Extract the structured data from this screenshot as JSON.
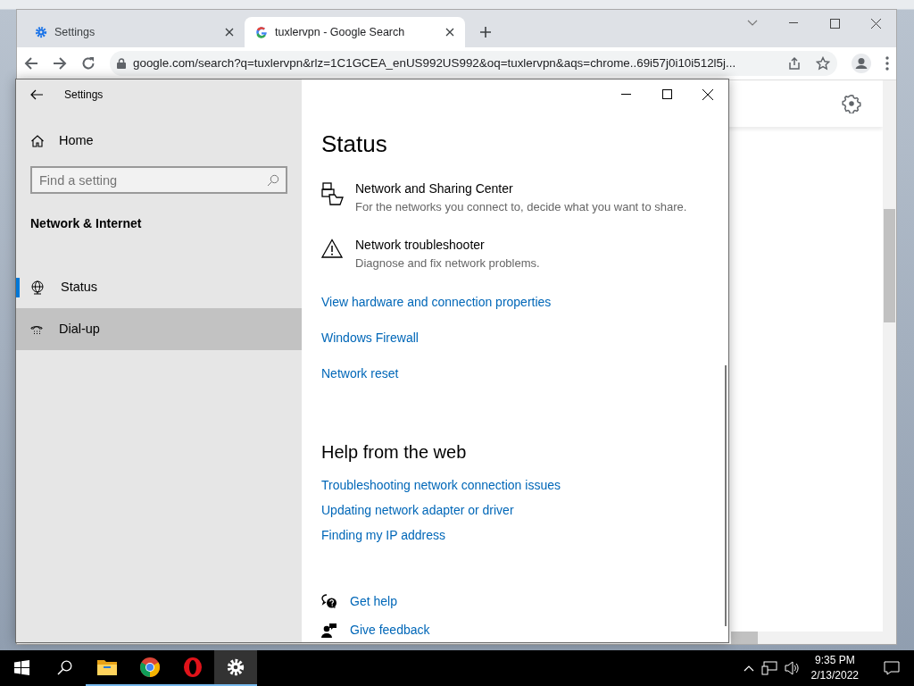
{
  "browser": {
    "tabs": [
      {
        "label": "Settings",
        "selected": false
      },
      {
        "label": "tuxlervpn - Google Search",
        "selected": true
      }
    ],
    "address": "google.com/search?q=tuxlervpn&rlz=1C1GCEA_enUS992US992&oq=tuxlervpn&aqs=chrome..69i57j0i10i512l5j..."
  },
  "settings": {
    "title": "Settings",
    "home": "Home",
    "search": {
      "placeholder": "Find a setting"
    },
    "section": "Network & Internet",
    "nav": [
      {
        "label": "Status",
        "selected": true,
        "hovered": false
      },
      {
        "label": "Dial-up",
        "selected": false,
        "hovered": true
      }
    ],
    "heading": "Status",
    "items": [
      {
        "title": "Network and Sharing Center",
        "description": "For the networks you connect to, decide what you want to share."
      },
      {
        "title": "Network troubleshooter",
        "description": "Diagnose and fix network problems."
      }
    ],
    "links": [
      "View hardware and connection properties",
      "Windows Firewall",
      "Network reset"
    ],
    "help": {
      "heading": "Help from the web",
      "links": [
        "Troubleshooting network connection issues",
        "Updating network adapter or driver",
        "Finding my IP address"
      ]
    },
    "actions": [
      "Get help",
      "Give feedback"
    ]
  },
  "taskbar": {
    "apps": [
      {
        "kind": "start",
        "running": false,
        "active": false
      },
      {
        "kind": "search",
        "running": false,
        "active": false
      },
      {
        "kind": "explorer",
        "running": true,
        "active": false
      },
      {
        "kind": "chrome",
        "running": true,
        "active": false
      },
      {
        "kind": "opera",
        "running": true,
        "active": false
      },
      {
        "kind": "settings",
        "running": true,
        "active": true
      }
    ],
    "time": "9:35 PM",
    "date": "2/13/2022"
  }
}
